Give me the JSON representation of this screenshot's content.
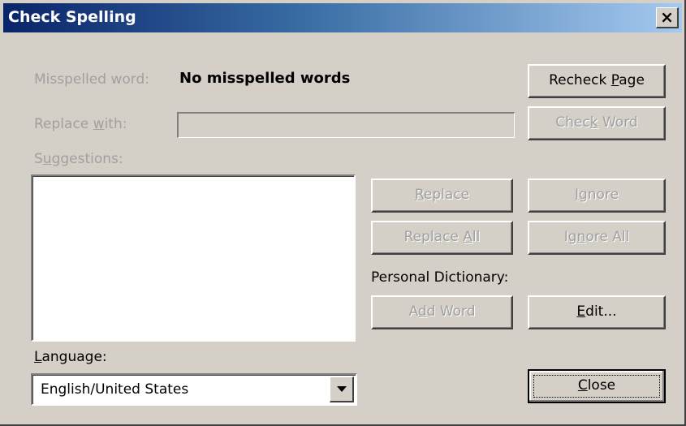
{
  "window": {
    "title": "Check Spelling",
    "close_glyph": "×"
  },
  "misspelled": {
    "label": "Misspelled word:",
    "value": "No misspelled words"
  },
  "replace_with": {
    "label_pre": "Replace ",
    "label_key": "w",
    "label_post": "ith:",
    "value": ""
  },
  "suggestions": {
    "label_pre": "S",
    "label_key": "u",
    "label_post": "ggestions:",
    "items": []
  },
  "language": {
    "label_key": "L",
    "label_post": "anguage:",
    "selected": "English/United States"
  },
  "personal_dictionary_label": "Personal Dictionary:",
  "buttons": {
    "recheck_page": {
      "pre": "Recheck ",
      "key": "P",
      "post": "age"
    },
    "check_word": {
      "pre": "Chec",
      "key": "k",
      "post": " Word"
    },
    "replace": {
      "pre": "",
      "key": "R",
      "post": "eplace"
    },
    "ignore": {
      "pre": "",
      "key": "I",
      "post": "gnore"
    },
    "replace_all": {
      "pre": "Replace ",
      "key": "A",
      "post": "ll"
    },
    "ignore_all": {
      "pre": "Ig",
      "key": "n",
      "post": "ore All"
    },
    "add_word": {
      "pre": "A",
      "key": "d",
      "post": "d Word"
    },
    "edit": {
      "pre": "",
      "key": "E",
      "post": "dit..."
    },
    "close": {
      "pre": "",
      "key": "C",
      "post": "lose"
    }
  },
  "colors": {
    "dialog_bg": "#d4d0c8",
    "title_start": "#0a246a",
    "title_end": "#a6caf0",
    "disabled_text": "#a0a0a0"
  }
}
